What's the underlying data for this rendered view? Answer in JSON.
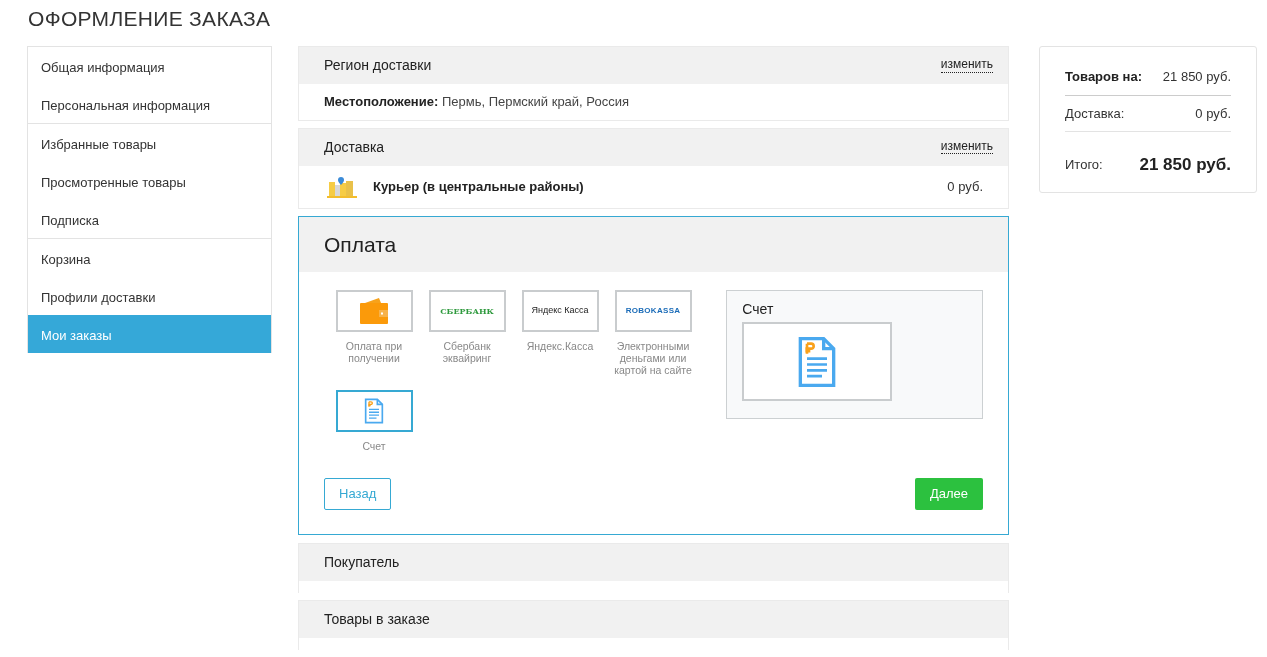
{
  "page_title": "ОФОРМЛЕНИЕ ЗАКАЗА",
  "sidebar": {
    "groups": [
      [
        {
          "label": "Общая информация",
          "selected": false
        },
        {
          "label": "Персональная информация",
          "selected": false
        }
      ],
      [
        {
          "label": "Избранные товары",
          "selected": false
        },
        {
          "label": "Просмотренные товары",
          "selected": false
        },
        {
          "label": "Подписка",
          "selected": false
        }
      ],
      [
        {
          "label": "Корзина",
          "selected": false
        },
        {
          "label": "Профили доставки",
          "selected": false
        },
        {
          "label": "Мои заказы",
          "selected": true
        }
      ]
    ]
  },
  "region": {
    "title": "Регион доставки",
    "change_link": "изменить",
    "location_label": "Местоположение:",
    "location_value": "Пермь, Пермский край, Россия"
  },
  "delivery": {
    "title": "Доставка",
    "change_link": "изменить",
    "service": "Курьер (в центральные районы)",
    "price": "0 руб."
  },
  "payment": {
    "title": "Оплата",
    "methods": [
      {
        "kind": "wallet",
        "label": "Оплата при получении",
        "selected": false
      },
      {
        "kind": "logo",
        "logo": "СБЕРБАНК",
        "label": "Сбербанк эквайринг",
        "selected": false
      },
      {
        "kind": "logo",
        "logo": "Яндекс Касса",
        "label": "Яндекс.Касса",
        "selected": false
      },
      {
        "kind": "logo",
        "logo": "ROBOKASSA",
        "label": "Электронными деньгами или картой на сайте",
        "selected": false
      },
      {
        "kind": "invoice",
        "label": "Счет",
        "selected": true
      }
    ],
    "detail_title": "Счет",
    "back_button": "Назад",
    "next_button": "Далее"
  },
  "collapsed_sections": [
    "Покупатель",
    "Товары в заказе"
  ],
  "summary": {
    "rows": [
      {
        "label": "Товаров на:",
        "value": "21 850 руб."
      },
      {
        "label": "Доставка:",
        "value": "0 руб."
      }
    ],
    "total_label": "Итого:",
    "total_value": "21 850 руб."
  }
}
